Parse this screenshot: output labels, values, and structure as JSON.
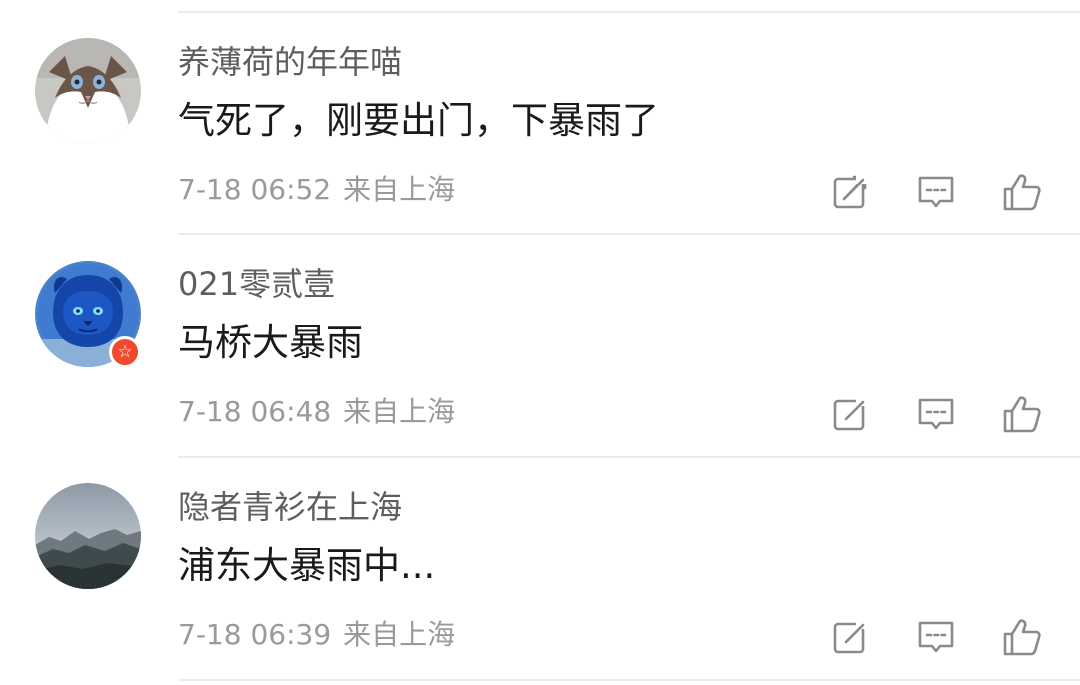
{
  "comments": [
    {
      "username": "养薄荷的年年喵",
      "content": "气死了，刚要出门，下暴雨了",
      "time": "7-18 06:52",
      "location": "来自上海",
      "avatar_icon": "cat-avatar",
      "has_badge": false
    },
    {
      "username": "021零贰壹",
      "content": "马桥大暴雨",
      "time": "7-18 06:48",
      "location": "来自上海",
      "avatar_icon": "blue-lion-avatar",
      "has_badge": true,
      "badge_icon": "star-badge-icon"
    },
    {
      "username": "隐者青衫在上海",
      "content": "浦东大暴雨中...",
      "time": "7-18 06:39",
      "location": "来自上海",
      "avatar_icon": "mountain-landscape-avatar",
      "has_badge": false
    }
  ],
  "actions": {
    "repost_icon": "share-icon",
    "reply_icon": "comment-icon",
    "like_icon": "thumbs-up-icon",
    "icon_color": "#8a8a8a"
  },
  "badge": {
    "glyph": "☆",
    "color": "#f04a2e"
  }
}
